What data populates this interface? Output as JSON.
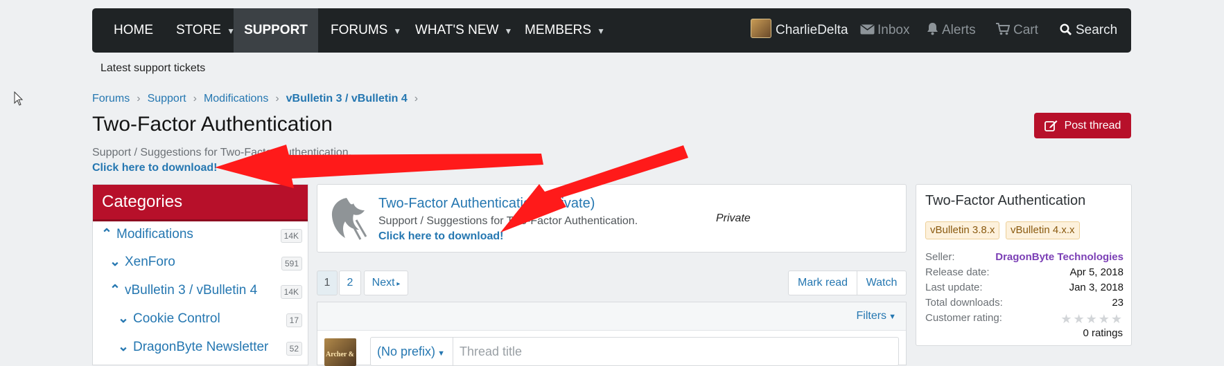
{
  "nav": {
    "home": "HOME",
    "store": "STORE",
    "support": "SUPPORT",
    "forums": "FORUMS",
    "whats_new": "WHAT'S NEW",
    "members": "MEMBERS",
    "user": "CharlieDelta",
    "inbox": "Inbox",
    "alerts": "Alerts",
    "cart": "Cart",
    "search": "Search"
  },
  "subnav": {
    "latest": "Latest support tickets"
  },
  "breadcrumb": [
    "Forums",
    "Support",
    "Modifications",
    "vBulletin 3 / vBulletin 4"
  ],
  "page": {
    "title": "Two-Factor Authentication",
    "description": "Support / Suggestions for Two-Factor Authentication.",
    "download": "Click here to download!",
    "post_thread": "Post thread"
  },
  "categories": {
    "title": "Categories",
    "items": [
      {
        "label": "Modifications",
        "count": "14K"
      },
      {
        "label": "XenForo",
        "count": "591"
      },
      {
        "label": "vBulletin 3 / vBulletin 4",
        "count": "14K"
      },
      {
        "label": "Cookie Control",
        "count": "17"
      },
      {
        "label": "DragonByte Newsletter",
        "count": "52"
      }
    ]
  },
  "resource": {
    "title": "Two-Factor Authentication (Private)",
    "description": "Support / Suggestions for Two-Factor Authentication.",
    "download": "Click here to download!",
    "private": "Private"
  },
  "pagination": {
    "page1": "1",
    "page2": "2",
    "next": "Next"
  },
  "actions": {
    "mark_read": "Mark read",
    "watch": "Watch"
  },
  "thread_list": {
    "filters": "Filters",
    "prefix": "(No prefix)",
    "placeholder": "Thread title",
    "avatar_text": "Archer &"
  },
  "info": {
    "title": "Two-Factor Authentication",
    "tags": [
      "vBulletin 3.8.x",
      "vBulletin 4.x.x"
    ],
    "seller_label": "Seller:",
    "seller": "DragonByte Technologies",
    "release_label": "Release date:",
    "release": "Apr 5, 2018",
    "update_label": "Last update:",
    "update": "Jan 3, 2018",
    "downloads_label": "Total downloads:",
    "downloads": "23",
    "rating_label": "Customer rating:",
    "rating_stars": 0,
    "ratings": "0 ratings"
  },
  "colors": {
    "brand_red": "#b7102a",
    "link_blue": "#2577b1",
    "nav_bg": "#1f2325",
    "seller_purple": "#7b3fb5",
    "arrow_red": "#ff0000"
  }
}
